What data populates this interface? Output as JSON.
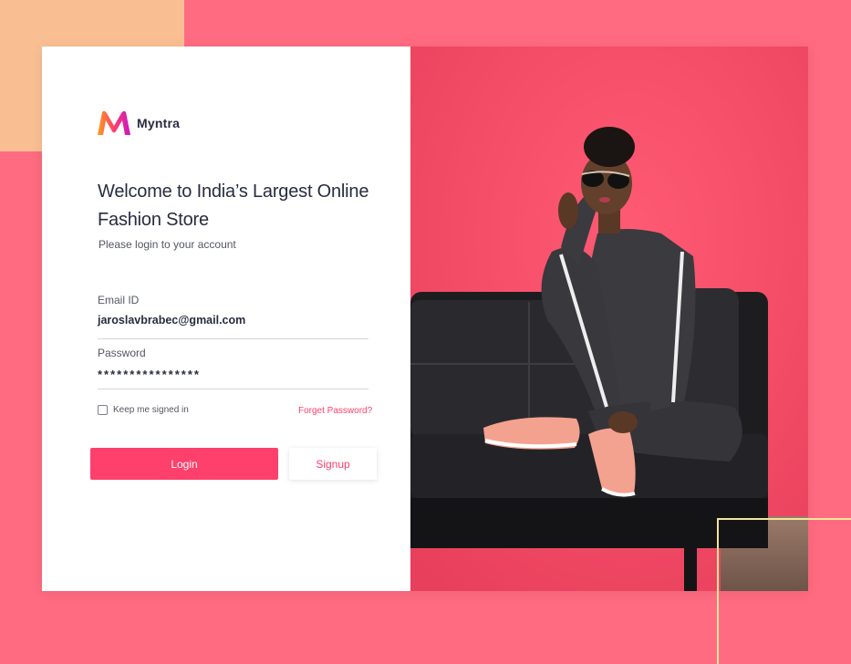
{
  "brand": {
    "name": "Myntra",
    "logo_icon": "myntra-m-logo",
    "colors": {
      "accent": "#ff3f6c",
      "logo_gradient": [
        "#ff9a1f",
        "#ff3f6c",
        "#c914c4"
      ]
    }
  },
  "login": {
    "title": "Welcome to India’s Largest Online Fashion Store",
    "subtitle": "Please login to your account",
    "email": {
      "label": "Email ID",
      "value": "jaroslavbrabec@gmail.com"
    },
    "password": {
      "label": "Password",
      "value": "****************"
    },
    "remember_label": "Keep me signed in",
    "remember_checked": false,
    "forgot_label": "Forget Password?",
    "login_label": "Login",
    "signup_label": "Signup"
  },
  "hero_image": {
    "subject": "fashion-model-on-sofa-photo"
  },
  "colors": {
    "page_background": "#ff6b81",
    "accent_block": "#f9bf93",
    "hero_wall": "#f8506a",
    "frame_line": "#f2e59a"
  }
}
